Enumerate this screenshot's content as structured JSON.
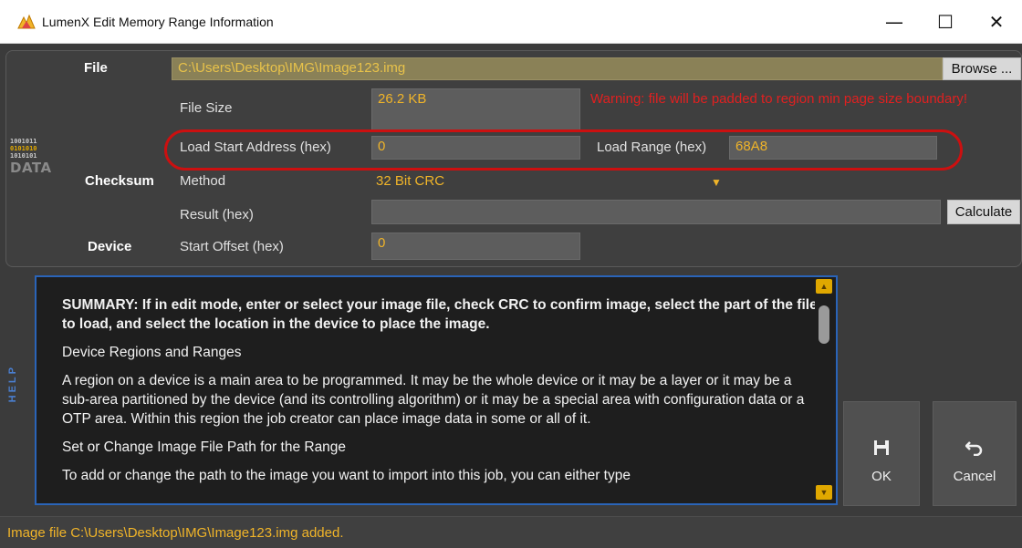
{
  "window": {
    "title": "LumenX Edit Memory Range Information",
    "icon": "lumenx-logo-icon",
    "controls": {
      "minimize": "—",
      "maximize": "☐",
      "close": "✕"
    }
  },
  "data_logo": {
    "bits": [
      "1001011",
      "0101010",
      "1010101"
    ],
    "word": "DATA"
  },
  "file": {
    "section_label": "File",
    "path": "C:\\Users\\Desktop\\IMG\\Image123.img",
    "browse_label": "Browse ...",
    "size_label": "File Size",
    "size_value": "26.2 KB",
    "warning": "Warning: file will be padded to region min page size boundary!",
    "load_start_label": "Load Start Address (hex)",
    "load_start_value": "0",
    "load_range_label": "Load Range (hex)",
    "load_range_value": "68A8"
  },
  "checksum": {
    "section_label": "Checksum",
    "method_label": "Method",
    "method_value": "32 Bit CRC",
    "result_label": "Result (hex)",
    "result_value": "",
    "calculate_label": "Calculate"
  },
  "device": {
    "section_label": "Device",
    "start_offset_label": "Start Offset (hex)",
    "start_offset_value": "0"
  },
  "help": {
    "side_label": "HELP",
    "summary": "SUMMARY: If in edit mode, enter or select your image file, check CRC to confirm image, select the part of the file to load, and select the location in the device to place the image.",
    "heading1": "Device Regions and Ranges",
    "para1": "A region on a device is a main area to be programmed.  It may be the whole device or it may be a layer or it may be a sub-area partitioned by the device (and its controlling algorithm) or it may be a special area with configuration data or a OTP area.  Within this region the job creator can place image data in some or all of it.",
    "heading2": "Set or Change Image File Path for the Range",
    "para2": "To add or change the path to the image you want to import into this job, you can either type"
  },
  "actions": {
    "ok_label": "OK",
    "ok_icon": "save-icon",
    "cancel_label": "Cancel",
    "cancel_icon": "undo-icon"
  },
  "status": {
    "message": "Image file C:\\Users\\Desktop\\IMG\\Image123.img added."
  },
  "colors": {
    "accent": "#f0b429",
    "warning": "#e02020",
    "highlight": "#cc1010",
    "help_border": "#2a64b8",
    "panel_bg": "#3f3f3f"
  }
}
